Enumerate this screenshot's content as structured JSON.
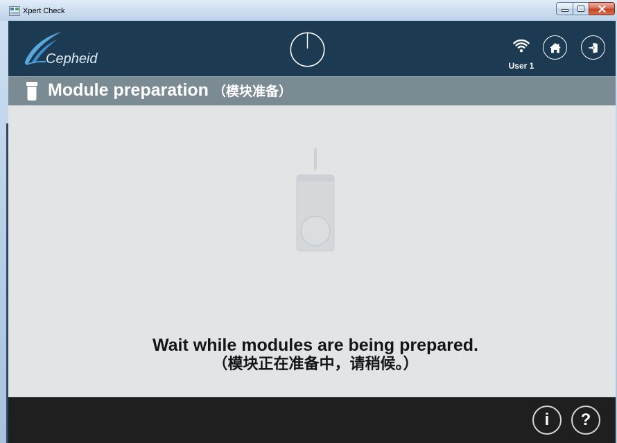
{
  "window": {
    "title": "Xpert Check",
    "icons": {
      "app": "app-icon",
      "minimize": "minimize-icon",
      "maximize": "maximize-icon",
      "close": "close-icon"
    }
  },
  "header": {
    "logo_text": "Cepheid",
    "user_label": "User 1",
    "icons": {
      "logo": "cepheid-logo-icon",
      "status": "timer-dial-icon",
      "network": "wifi-icon",
      "home": "home-icon",
      "logout": "logout-icon"
    }
  },
  "section_bar": {
    "icon": "module-icon",
    "title": "Module preparation",
    "title_cn": "（模块准备）"
  },
  "main": {
    "illustration": "module-illustration-icon",
    "message": "Wait while modules are being prepared.",
    "message_cn": "（模块正在准备中，请稍候。）"
  },
  "footer": {
    "info_label": "i",
    "help_label": "?",
    "icons": {
      "info": "info-icon",
      "help": "help-icon"
    }
  },
  "colors": {
    "header_bg": "#1c3a51",
    "section_bar_bg": "#7a8b94",
    "main_bg": "#e2e4e6",
    "footer_bg": "#1f1f1f",
    "logo_accent": "#59a9df",
    "close_button": "#c4411f"
  }
}
